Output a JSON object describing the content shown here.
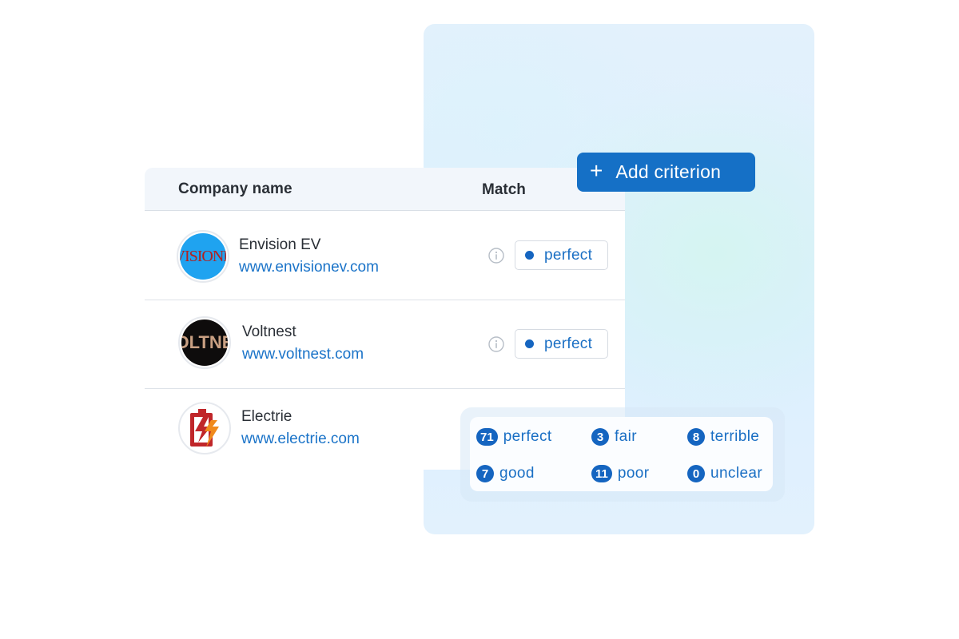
{
  "table": {
    "header": {
      "company": "Company name",
      "match": "Match"
    },
    "rows": [
      {
        "name": "Envision EV",
        "url": "www.envisionev.com",
        "logo_text": "VISIONE",
        "match": "perfect"
      },
      {
        "name": "Voltnest",
        "url": "www.voltnest.com",
        "logo_text": "OLTNE",
        "match": "perfect"
      },
      {
        "name": "Electrie",
        "url": "www.electrie.com",
        "logo_text": "",
        "match": ""
      }
    ]
  },
  "add_criterion": {
    "icon": "plus-icon",
    "label": "Add criterion"
  },
  "stats": [
    {
      "count": "71",
      "label": "perfect"
    },
    {
      "count": "3",
      "label": "fair"
    },
    {
      "count": "8",
      "label": "terrible"
    },
    {
      "count": "7",
      "label": "good"
    },
    {
      "count": "11",
      "label": "poor"
    },
    {
      "count": "0",
      "label": "unclear"
    }
  ],
  "colors": {
    "accent": "#1570c6",
    "link": "#1a73c8",
    "badge_dot": "#1565c0"
  }
}
